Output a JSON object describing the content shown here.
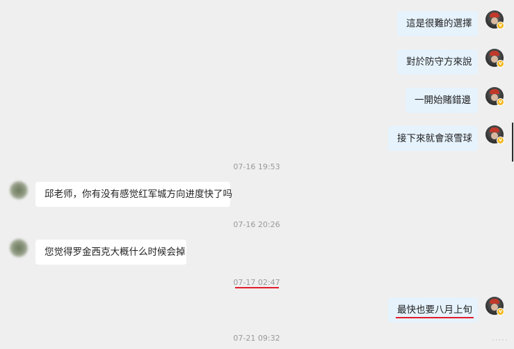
{
  "messages_outgoing_top": [
    {
      "text": "這是很難的選擇"
    },
    {
      "text": "對於防守方來說"
    },
    {
      "text": "一開始賭錯邊"
    },
    {
      "text": "接下來就會滾雪球"
    }
  ],
  "timestamps": {
    "t1": "07-16 19:53",
    "t2": "07-16 20:26",
    "t3": "07-17 02:47",
    "t4": "07-21 09:32"
  },
  "incoming": [
    {
      "text": "邱老师，你有没有感觉红军城方向进度快了吗"
    },
    {
      "text": "您觉得罗金西克大概什么时候会掉"
    }
  ],
  "outgoing_bottom": {
    "text": "最快也要八月上旬"
  },
  "badge_symbol": "v",
  "watermark": "·····",
  "colors": {
    "annotation_red": "#e21b2a",
    "outgoing_bubble": "#e6f3fd",
    "incoming_bubble": "#ffffff"
  }
}
